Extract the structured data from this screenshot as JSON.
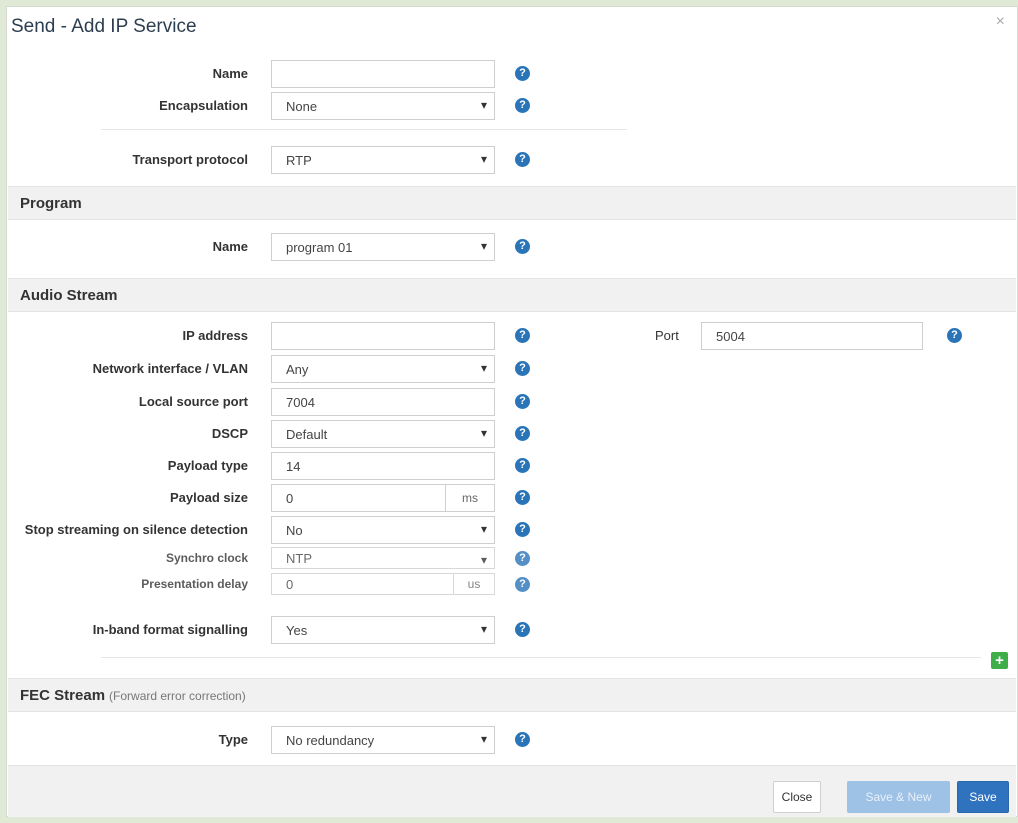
{
  "dialog": {
    "title": "Send - Add IP Service",
    "close_glyph": "×"
  },
  "help_glyph": "?",
  "general": {
    "name": {
      "label": "Name",
      "value": ""
    },
    "encapsulation": {
      "label": "Encapsulation",
      "value": "None"
    },
    "transport": {
      "label": "Transport protocol",
      "value": "RTP"
    }
  },
  "program": {
    "title": "Program",
    "name": {
      "label": "Name",
      "value": "program 01"
    }
  },
  "audio": {
    "title": "Audio Stream",
    "ip_address": {
      "label": "IP address",
      "value": ""
    },
    "port": {
      "label": "Port",
      "value": "5004"
    },
    "network": {
      "label": "Network interface / VLAN",
      "value": "Any"
    },
    "local_port": {
      "label": "Local source port",
      "value": "7004"
    },
    "dscp": {
      "label": "DSCP",
      "value": "Default"
    },
    "payload_type": {
      "label": "Payload type",
      "value": "14"
    },
    "payload_size": {
      "label": "Payload size",
      "value": "0",
      "unit": "ms"
    },
    "silence": {
      "label": "Stop streaming on silence detection",
      "value": "No"
    },
    "sync_clock": {
      "label": "Synchro clock",
      "value": "NTP"
    },
    "presentation_delay": {
      "label": "Presentation delay",
      "value": "0",
      "unit": "us"
    },
    "inband": {
      "label": "In-band format signalling",
      "value": "Yes"
    },
    "add_glyph": "+"
  },
  "fec": {
    "title": "FEC Stream",
    "subtitle": "(Forward error correction)",
    "type": {
      "label": "Type",
      "value": "No redundancy"
    }
  },
  "footer": {
    "close": "Close",
    "save_new": "Save & New",
    "save": "Save"
  },
  "colors": {
    "primary": "#2f73bf",
    "help": "#2a74b8",
    "add": "#3fae49",
    "disabled": "#9ec1e6"
  }
}
